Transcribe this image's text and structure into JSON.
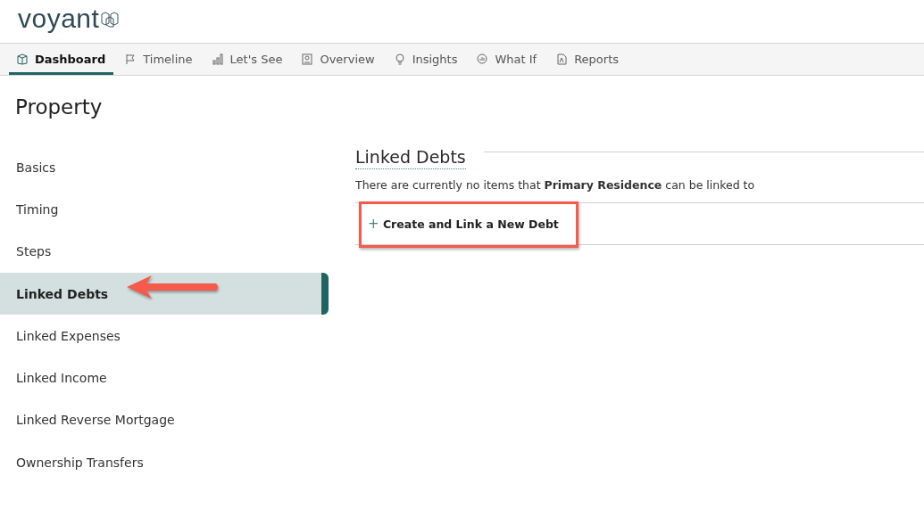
{
  "logo": {
    "text": "voyant"
  },
  "tabs": [
    {
      "label": "Dashboard",
      "selected": true
    },
    {
      "label": "Timeline",
      "selected": false
    },
    {
      "label": "Let's See",
      "selected": false
    },
    {
      "label": "Overview",
      "selected": false
    },
    {
      "label": "Insights",
      "selected": false
    },
    {
      "label": "What If",
      "selected": false
    },
    {
      "label": "Reports",
      "selected": false
    }
  ],
  "page_title": "Property",
  "sidebar": {
    "items": [
      {
        "label": "Basics",
        "selected": false
      },
      {
        "label": "Timing",
        "selected": false
      },
      {
        "label": "Steps",
        "selected": false
      },
      {
        "label": "Linked Debts",
        "selected": true
      },
      {
        "label": "Linked Expenses",
        "selected": false
      },
      {
        "label": "Linked Income",
        "selected": false
      },
      {
        "label": "Linked Reverse Mortgage",
        "selected": false
      },
      {
        "label": "Ownership Transfers",
        "selected": false
      }
    ]
  },
  "section": {
    "title": "Linked Debts",
    "message": "There are currently no items that **Primary Residence** can be linked to",
    "action": {
      "icon": "+",
      "label": "Create and Link a New Debt"
    }
  }
}
